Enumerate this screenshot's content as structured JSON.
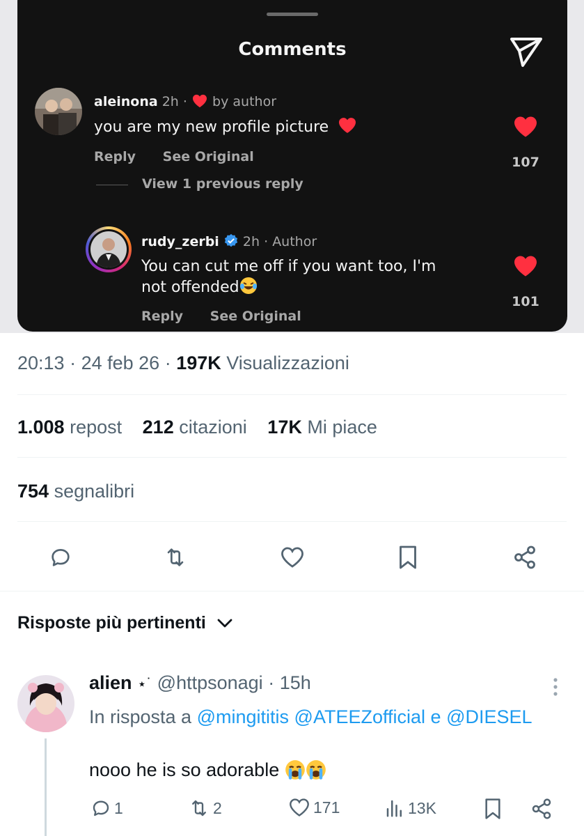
{
  "ig_card": {
    "title": "Comments",
    "comments": [
      {
        "username": "aleinona",
        "time": "2h",
        "separator": "·",
        "badge": "by author",
        "text": "you are my new profile picture",
        "reply_label": "Reply",
        "see_original_label": "See Original",
        "likes": "107"
      },
      {
        "username": "rudy_zerbi",
        "time": "2h",
        "separator": "·",
        "badge": "Author",
        "text_line1": "You can cut me off if you want too, I'm",
        "text_line2": "not offended",
        "reply_label": "Reply",
        "see_original_label": "See Original",
        "likes": "101"
      }
    ],
    "view_replies_label": "View 1 previous reply"
  },
  "tweet": {
    "time": "20:13",
    "date": "24 feb 26",
    "views_count": "197K",
    "views_label": "Visualizzazioni",
    "reposts_count": "1.008",
    "reposts_label": "repost",
    "quotes_count": "212",
    "quotes_label": "citazioni",
    "likes_count": "17K",
    "likes_label": "Mi piace",
    "bookmarks_count": "754",
    "bookmarks_label": "segnalibri"
  },
  "sort": {
    "label": "Risposte più pertinenti"
  },
  "reply": {
    "display_name": "alien",
    "name_suffix": "⋆˙",
    "handle": "@httpsonagi",
    "time": "15h",
    "in_reply_prefix": "In risposta a",
    "mentions": [
      "@mingititis",
      "@ATEEZofficial",
      "@DIESEL"
    ],
    "conjunction": "e",
    "text": "nooo he is so adorable",
    "replies": "1",
    "reposts": "2",
    "likes": "171",
    "views": "13K"
  },
  "icons": {
    "heart_color": "#ff3040",
    "verified_color": "#3897f0",
    "link_color": "#1d9bf0"
  }
}
